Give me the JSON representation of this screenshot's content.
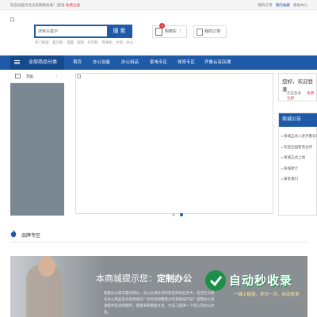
{
  "topbar": {
    "welcome": "欢迎光临河北沃思网络商城！[登录",
    "register": "免费注册",
    "links": [
      "我的订单",
      "我的收藏",
      "帮助中心"
    ]
  },
  "search": {
    "placeholder": "搜索关键字",
    "button": "搜 索",
    "hotwords": [
      "热门搜索",
      "复印机",
      "电脑",
      "碳粉",
      "打印机",
      "传真机",
      "文具",
      "办公"
    ]
  },
  "cart": {
    "count": "0",
    "label": "购物车",
    "arrow": "〉"
  },
  "orders": {
    "label": "我的订单",
    "arrow": "〉"
  },
  "nav": {
    "all_categories": "全部商品分类",
    "items": [
      "首页",
      "办公设备",
      "办公用品",
      "家电专区",
      "体育专区",
      "齐鲁云采店铺"
    ]
  },
  "category_panel": {
    "items": [
      {
        "label": "票据",
        "arrow": "〉"
      }
    ]
  },
  "banner": {
    "slide_count": 2,
    "active_slide": 2
  },
  "userbox": {
    "greeting": "您好，欢迎登录",
    "login": "点击登录",
    "register": "免费注册"
  },
  "notice": {
    "title": "商城公告",
    "items": [
      "商城正式入驻齐鲁云采",
      "欢迎全国客商合作",
      "商城正式上线",
      "商城简介",
      "联系我们"
    ]
  },
  "brand": {
    "label": "品牌专区"
  },
  "promo": {
    "title_prefix": "本商城提示您：",
    "title_bold": "定制办公",
    "body": "随着办公需求量的增长，办公文具在材料新型商场业务中，您还在为购买办公用品及文具烦恼吗？如何采购整套文印及贴纸产品？鉴需办公资源提供您采购便利，需要采购整套文具，为员工提供一个舒心的办公体验。",
    "watermark_title": "自动秒收录",
    "watermark_sub": "一键上链接，来访一次，自动收录"
  },
  "colors": {
    "primary": "#1e5aa8",
    "accent": "#e4393c",
    "nav_dark": "#164a8f"
  }
}
